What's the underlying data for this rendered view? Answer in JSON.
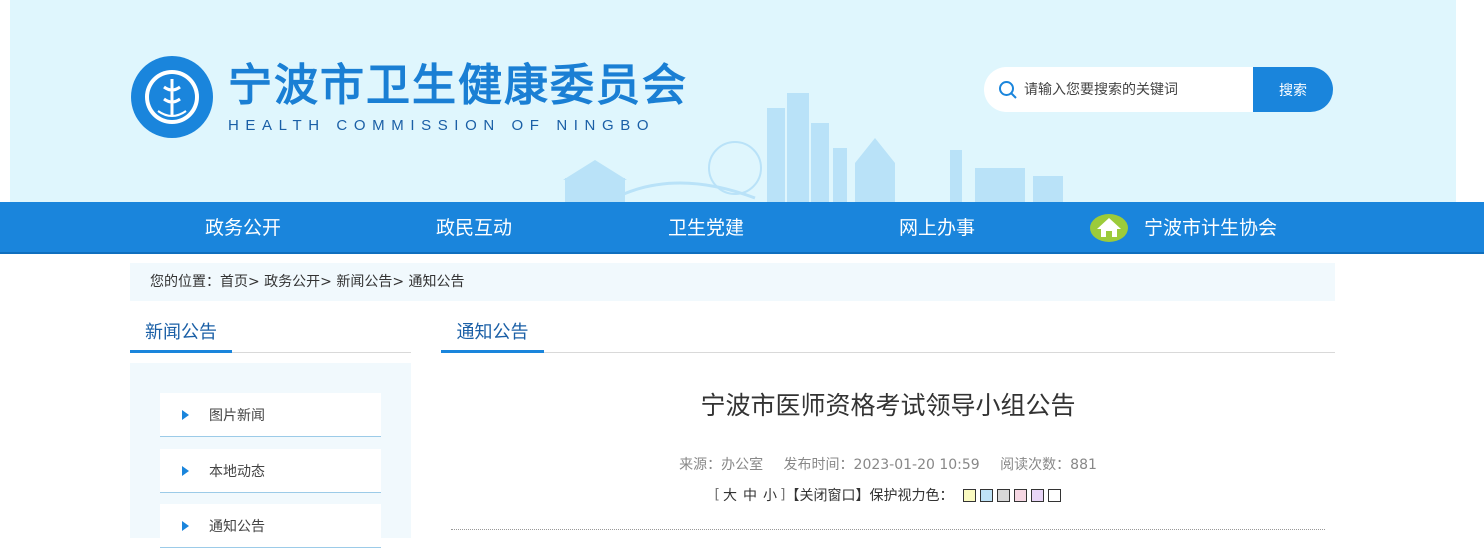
{
  "header": {
    "logo_cn": "宁波市卫生健康委员会",
    "logo_en": "HEALTH COMMISSION OF NINGBO",
    "emblem_text": "宁波市卫生健康委员会 HEALTH COMMISSION OF NINGBO"
  },
  "search": {
    "placeholder": "请输入您要搜索的关键词",
    "button": "搜索"
  },
  "nav": {
    "items": [
      "政务公开",
      "政民互动",
      "卫生党建",
      "网上办事"
    ],
    "special": "宁波市计生协会"
  },
  "breadcrumb": {
    "text": "您的位置：首页> 政务公开> 新闻公告> 通知公告"
  },
  "sidebar": {
    "title": "新闻公告",
    "items": [
      "图片新闻",
      "本地动态",
      "通知公告"
    ]
  },
  "main": {
    "section_title": "通知公告",
    "article_title": "宁波市医师资格考试领导小组公告",
    "source": "来源：办公室",
    "publish_time": "发布时间：2023-01-20 10:59",
    "views": "阅读次数：881",
    "font_open": "[",
    "font_large": "大",
    "font_medium": "中",
    "font_small": "小",
    "font_close": "]",
    "close_window": "【关闭窗口】",
    "eye_color_label": "保护视力色：",
    "swatch_colors": [
      "#fafac0",
      "#bfe3f7",
      "#d7d7d7",
      "#f6d7e3",
      "#e8d5f7",
      "#ffffff"
    ]
  }
}
